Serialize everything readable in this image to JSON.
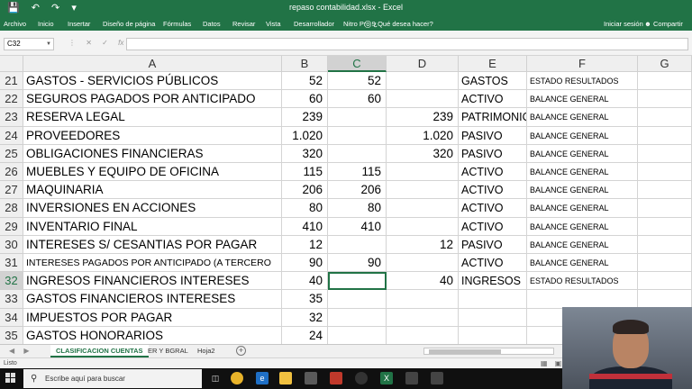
{
  "window": {
    "title": "repaso contabilidad.xlsx - Excel"
  },
  "ribbon": {
    "tabs": [
      "Archivo",
      "Inicio",
      "Insertar",
      "Diseño de página",
      "Fórmulas",
      "Datos",
      "Revisar",
      "Vista",
      "Desarrollador",
      "Nitro Pro 9"
    ],
    "tell_me": "¿Qué desea hacer?",
    "sign_in": "Iniciar sesión",
    "share": "Compartir"
  },
  "formula_bar": {
    "name_box": "C32",
    "content": ""
  },
  "columns": [
    "A",
    "B",
    "C",
    "D",
    "E",
    "F",
    "G"
  ],
  "selected_column": "C",
  "selected_row": "32",
  "rows": [
    {
      "num": "21",
      "A": "GASTOS - SERVICIOS PÚBLICOS",
      "B": "52",
      "C": "52",
      "D": "",
      "E": "GASTOS",
      "F": "ESTADO RESULTADOS"
    },
    {
      "num": "22",
      "A": "SEGUROS PAGADOS POR ANTICIPADO",
      "B": "60",
      "C": "60",
      "D": "",
      "E": "ACTIVO",
      "F": "BALANCE GENERAL"
    },
    {
      "num": "23",
      "A": "RESERVA LEGAL",
      "B": "239",
      "C": "",
      "D": "239",
      "E": "PATRIMONIO",
      "F": "BALANCE GENERAL"
    },
    {
      "num": "24",
      "A": "PROVEEDORES",
      "B": "1.020",
      "C": "",
      "D": "1.020",
      "E": "PASIVO",
      "F": "BALANCE GENERAL"
    },
    {
      "num": "25",
      "A": "OBLIGACIONES FINANCIERAS",
      "B": "320",
      "C": "",
      "D": "320",
      "E": "PASIVO",
      "F": "BALANCE GENERAL"
    },
    {
      "num": "26",
      "A": "MUEBLES Y EQUIPO DE OFICINA",
      "B": "115",
      "C": "115",
      "D": "",
      "E": "ACTIVO",
      "F": "BALANCE GENERAL"
    },
    {
      "num": "27",
      "A": "MAQUINARIA",
      "B": "206",
      "C": "206",
      "D": "",
      "E": "ACTIVO",
      "F": "BALANCE GENERAL"
    },
    {
      "num": "28",
      "A": "INVERSIONES EN ACCIONES",
      "B": "80",
      "C": "80",
      "D": "",
      "E": "ACTIVO",
      "F": "BALANCE GENERAL"
    },
    {
      "num": "29",
      "A": "INVENTARIO FINAL",
      "B": "410",
      "C": "410",
      "D": "",
      "E": "ACTIVO",
      "F": "BALANCE GENERAL"
    },
    {
      "num": "30",
      "A": "INTERESES S/ CESANTIAS POR PAGAR",
      "B": "12",
      "C": "",
      "D": "12",
      "E": "PASIVO",
      "F": "BALANCE GENERAL"
    },
    {
      "num": "31",
      "A": "INTERESES PAGADOS POR ANTICIPADO (A TERCERO",
      "B": "90",
      "C": "90",
      "D": "",
      "E": "ACTIVO",
      "F": "BALANCE GENERAL"
    },
    {
      "num": "32",
      "A": "INGRESOS FINANCIEROS INTERESES",
      "B": "40",
      "C": "",
      "D": "40",
      "E": "INGRESOS",
      "F": "ESTADO RESULTADOS"
    },
    {
      "num": "33",
      "A": "GASTOS FINANCIEROS INTERESES",
      "B": "35",
      "C": "",
      "D": "",
      "E": "",
      "F": ""
    },
    {
      "num": "34",
      "A": "IMPUESTOS POR PAGAR",
      "B": "32",
      "C": "",
      "D": "",
      "E": "",
      "F": ""
    },
    {
      "num": "35",
      "A": "GASTOS HONORARIOS",
      "B": "24",
      "C": "",
      "D": "",
      "E": "",
      "F": ""
    }
  ],
  "sheet_tabs": [
    "CLASIFICACION CUENTAS",
    "ER Y BGRAL",
    "Hoja2"
  ],
  "active_sheet": "CLASIFICACION CUENTAS",
  "status": {
    "ready": "Listo"
  },
  "taskbar": {
    "search_placeholder": "Escribe aquí para buscar"
  },
  "colors": {
    "excel_green": "#217346",
    "taskbar": "#101010"
  }
}
